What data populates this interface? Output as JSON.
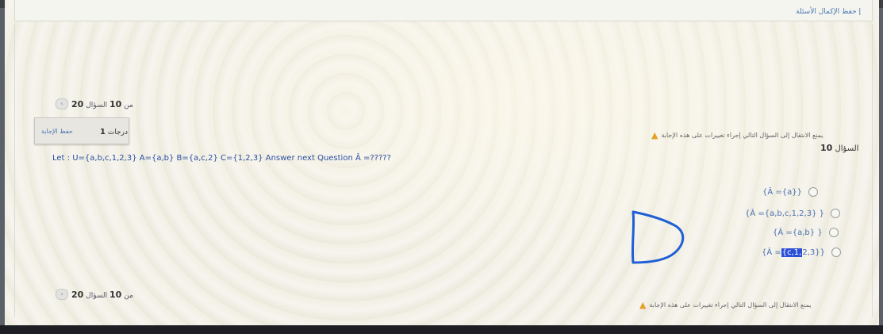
{
  "header": {
    "help_link": "إ حفظ الإكمال الأسئلة"
  },
  "navigation": {
    "question_label": "السؤال",
    "current": "10",
    "of_label": "من",
    "total": "20",
    "prev_icon": "chevron-left-icon"
  },
  "warning": {
    "icon": "warning-triangle-icon",
    "text": "يمنع الانتقال إلى السؤال التالي إجراء تغييرات على هذه الإجابة"
  },
  "marks_box": {
    "marks_value": "1",
    "marks_label": "درجات",
    "save_label": "حفظ الإجابة"
  },
  "question": {
    "number_label": "السؤال",
    "number": "10",
    "text": "Let : U={a,b,c,1,2,3} A={a,b} B={a,c,2} C={1,2,3} Answer next Question  Â =?????"
  },
  "options": [
    {
      "label": "{Â ={a}}"
    },
    {
      "label": "{Â ={a,b,c,1,2,3} }"
    },
    {
      "label": "{Â ={a,b} }"
    },
    {
      "label_pre": "{Â =",
      "label_hl": "{c,1,",
      "label_post": "2,3}}"
    }
  ],
  "colors": {
    "link": "#4a78b3",
    "option_text": "#4a6fb0",
    "warning": "#e6a12a",
    "scribble": "#1f5fd6",
    "highlight": "#2c4fd8"
  }
}
